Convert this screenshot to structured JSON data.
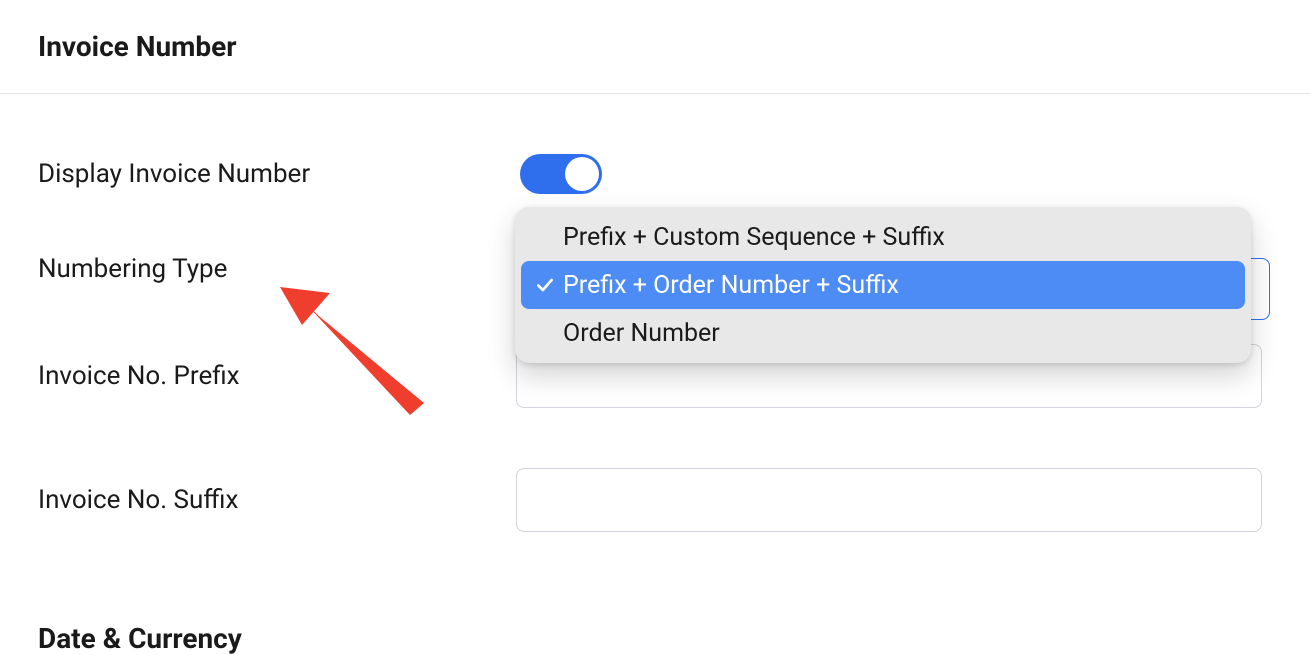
{
  "section": {
    "title": "Invoice Number"
  },
  "fields": {
    "display_invoice_number": {
      "label": "Display Invoice Number",
      "value": true
    },
    "numbering_type": {
      "label": "Numbering Type",
      "options": [
        "Prefix + Custom Sequence + Suffix",
        "Prefix + Order Number + Suffix",
        "Order Number"
      ],
      "selected_index": 1
    },
    "prefix": {
      "label": "Invoice No. Prefix",
      "value": ""
    },
    "suffix": {
      "label": "Invoice No. Suffix",
      "value": ""
    }
  },
  "next_section": {
    "title": "Date & Currency"
  },
  "annotation": {
    "arrow_color": "#ef3e2d"
  }
}
